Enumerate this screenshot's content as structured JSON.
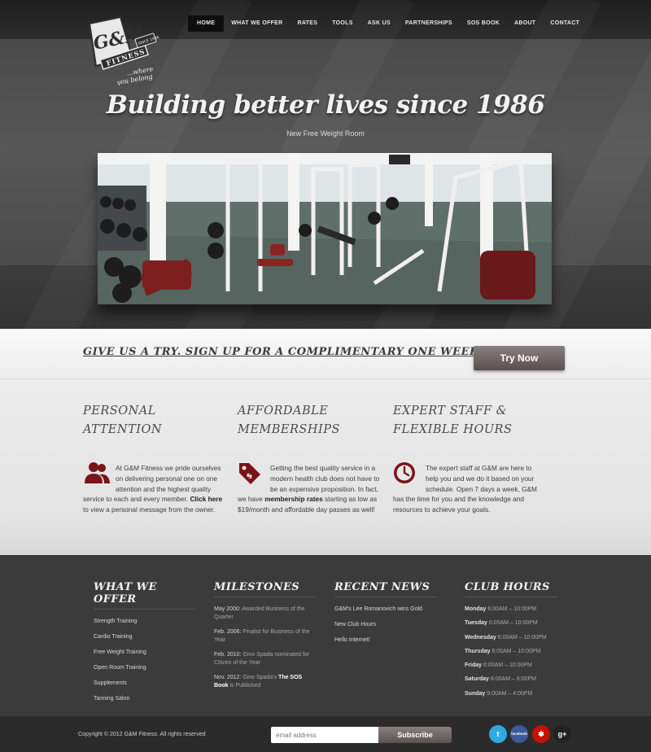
{
  "nav": {
    "items": [
      {
        "label": "HOME"
      },
      {
        "label": "WHAT WE OFFER"
      },
      {
        "label": "RATES"
      },
      {
        "label": "TOOLS"
      },
      {
        "label": "ASK US"
      },
      {
        "label": "PARTNERSHIPS"
      },
      {
        "label": "SOS BOOK"
      },
      {
        "label": "ABOUT"
      },
      {
        "label": "CONTACT"
      }
    ],
    "active": "HOME"
  },
  "logo": {
    "brand": "G&M",
    "word": "FITNESS",
    "since": "SINCE 1986",
    "tagline_1": "...where",
    "tagline_2": "you belong"
  },
  "hero": {
    "heading": "Building better lives since 1986",
    "caption": "New Free Weight Room"
  },
  "trial": {
    "text": "GIVE US A TRY. SIGN UP FOR A COMPLIMENTARY ONE WEEK TRIAL",
    "button": "Try Now"
  },
  "features": [
    {
      "title_1": "PERSONAL",
      "title_2": "ATTENTION",
      "icon": "people-icon",
      "text_a": "At G&M Fitness we pride ourselves on delivering personal one on one attention and the highest quality service to each and every member. ",
      "link": "Click here",
      "text_b": " to view a personal message from the owner."
    },
    {
      "title_1": "AFFORDABLE",
      "title_2": "MEMBERSHIPS",
      "icon": "price-tag-icon",
      "text_a": "Getting the best quality service in a modern health club does not have to be an expensive proposition. In fact, we have ",
      "link": "membership rates",
      "text_b": " starting as low as $19/month and affordable day passes as well!"
    },
    {
      "title_1": "EXPERT STAFF &",
      "title_2": "FLEXIBLE HOURS",
      "icon": "clock-icon",
      "text_a": "The expert staff at G&M are here to help you and we do it based on your schedule. Open 7 days a week, G&M has the time for you and the knowledge and resources to achieve your goals.",
      "link": "",
      "text_b": ""
    }
  ],
  "accent_color": "#7a1416",
  "footer": {
    "offer": {
      "title": "WHAT WE OFFER",
      "items": [
        "Strength Training",
        "Cardio Training",
        "Free Weight Training",
        "Open Room Training",
        "Supplements",
        "Tanning Salon"
      ]
    },
    "milestones": {
      "title": "MILESTONES",
      "items": [
        {
          "date": "May 2000:",
          "text": " Awarded Business of the Quarter",
          "bold": "",
          "tail": ""
        },
        {
          "date": "Feb. 2006:",
          "text": " Finalist for Business of the Year",
          "bold": "",
          "tail": ""
        },
        {
          "date": "Feb. 2010:",
          "text": " Gino Spada nominated for Citizen of the Year",
          "bold": "",
          "tail": ""
        },
        {
          "date": "Nov. 2012:",
          "text": " Gino Spada's ",
          "bold": "The SOS Book",
          "tail": " is Published"
        }
      ]
    },
    "news": {
      "title": "RECENT NEWS",
      "items": [
        "G&M's Lee Romanovich wins Gold",
        "New Club Hours",
        "Hello Internet!"
      ]
    },
    "hours": {
      "title": "CLUB HOURS",
      "items": [
        {
          "day": "Monday",
          "time": "6:00AM – 10:00PM"
        },
        {
          "day": "Tuesday",
          "time": "6:00AM – 10:00PM"
        },
        {
          "day": "Wednesday",
          "time": "6:00AM – 10:00PM"
        },
        {
          "day": "Thursday",
          "time": "6:00AM – 10:00PM"
        },
        {
          "day": "Friday",
          "time": "6:00AM – 10:00PM"
        },
        {
          "day": "Saturday",
          "time": "8:00AM – 6:00PM"
        },
        {
          "day": "Sunday",
          "time": "9:00AM – 4:00PM"
        }
      ]
    }
  },
  "bottom": {
    "copyright": "Copyright © 2012 G&M Fitness.  All rights reserved",
    "email_placeholder": "email address",
    "subscribe": "Subscribe",
    "social": [
      {
        "name": "twitter-icon",
        "glyph": "t",
        "color": "#2fa9e0"
      },
      {
        "name": "facebook-icon",
        "glyph": "facebook",
        "color": "#3b5a98"
      },
      {
        "name": "yelp-icon",
        "glyph": "✱",
        "color": "#c41200"
      },
      {
        "name": "google-plus-icon",
        "glyph": "g+",
        "color": "#222222"
      }
    ]
  }
}
